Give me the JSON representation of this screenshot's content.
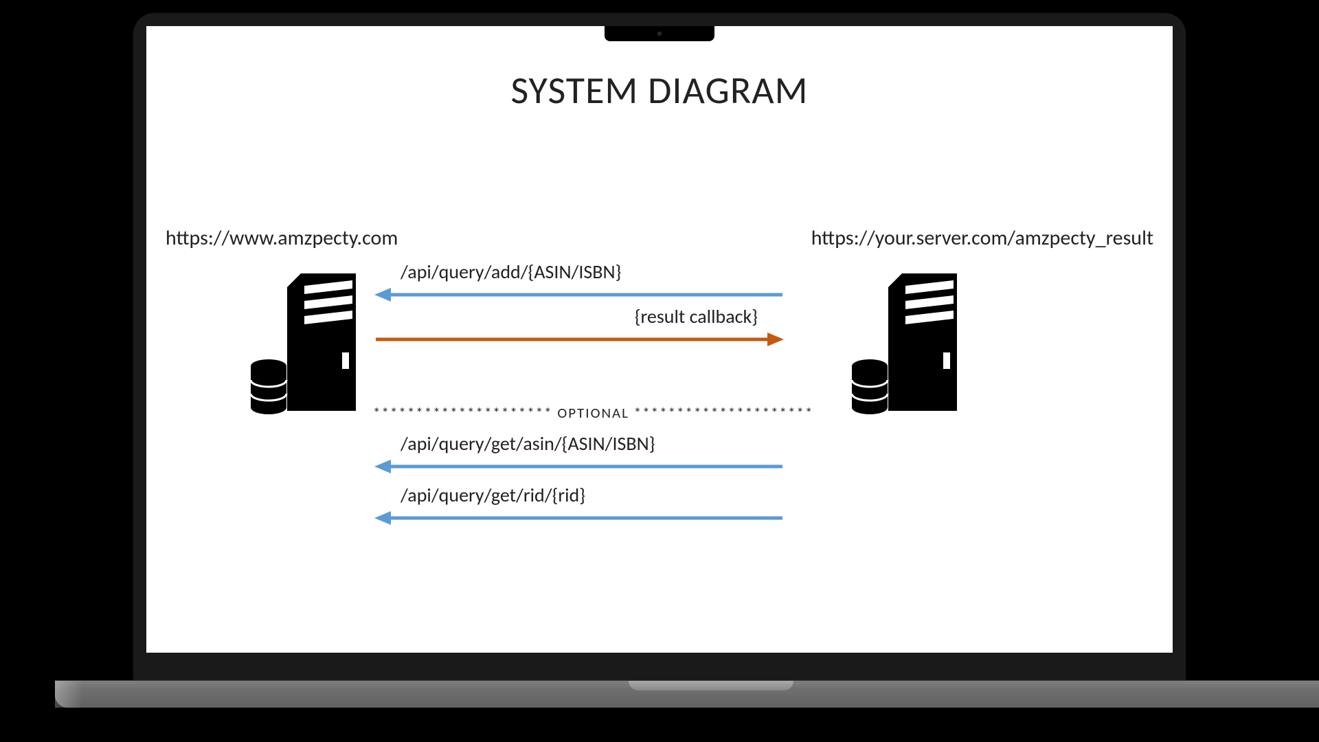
{
  "diagram": {
    "title": "SYSTEM DIAGRAM",
    "left_server_url": "https://www.amzpecty.com",
    "right_server_url": "https://your.server.com/amzpecty_result",
    "arrows": {
      "add_query": "/api/query/add/{ASIN/ISBN}",
      "callback": "{result callback}",
      "get_asin": "/api/query/get/asin/{ASIN/ISBN}",
      "get_rid": "/api/query/get/rid/{rid}"
    },
    "optional_label": "********************* OPTIONAL *********************",
    "colors": {
      "blue": "#5B9BD5",
      "orange": "#C55A11"
    }
  }
}
